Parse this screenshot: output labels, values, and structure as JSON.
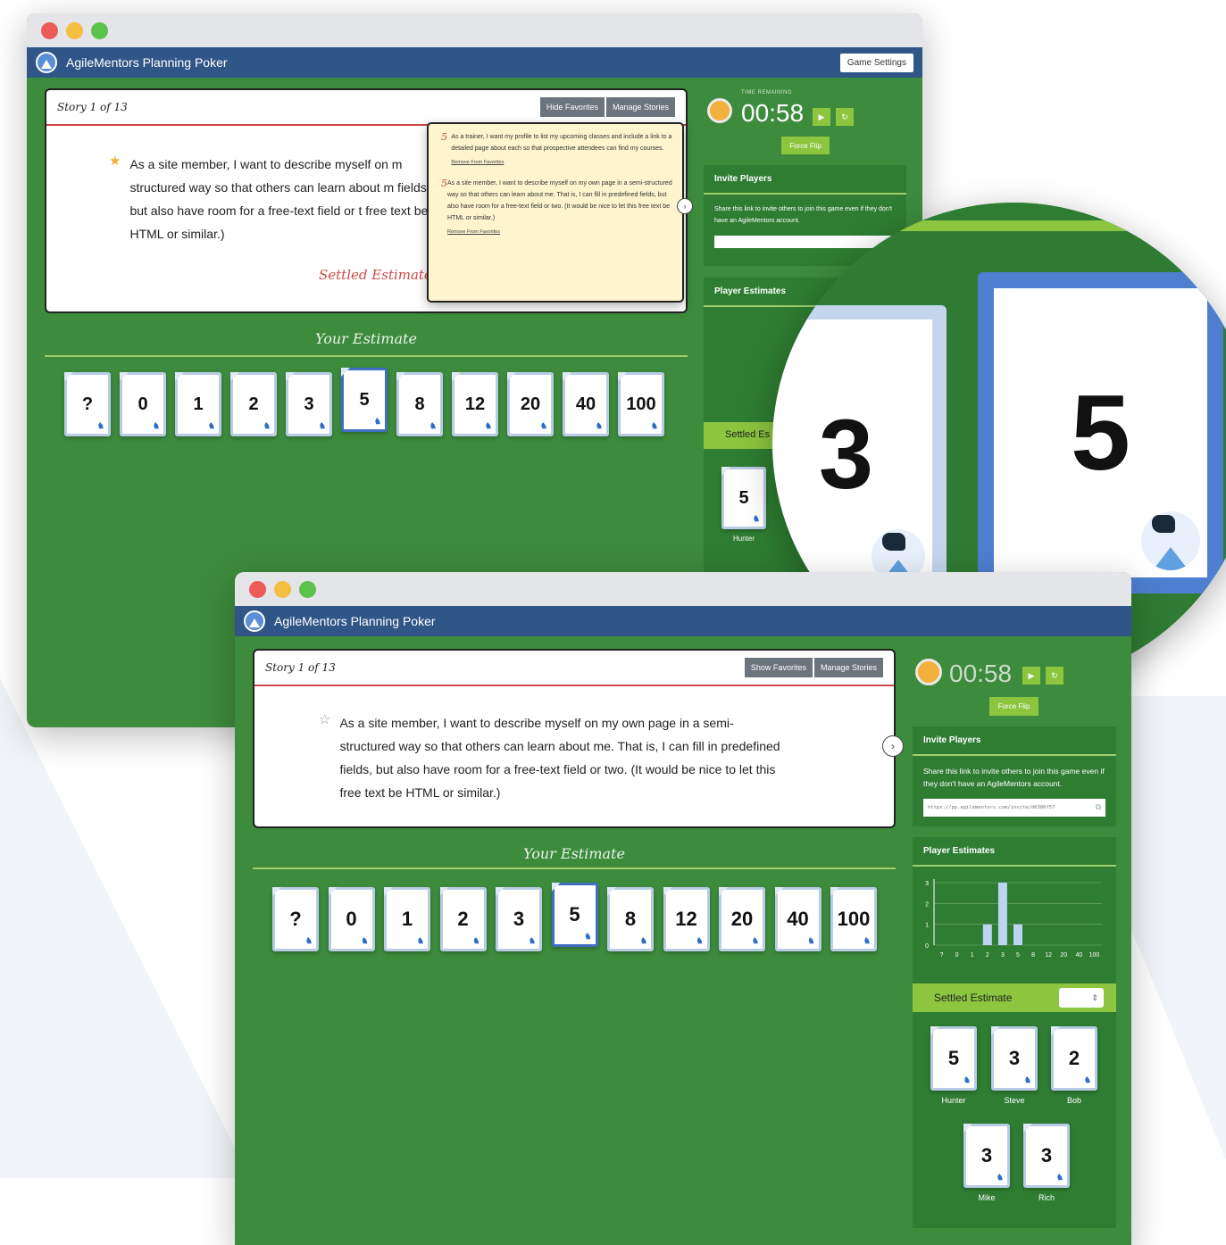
{
  "app": {
    "title": "AgileMentors Planning Poker",
    "game_settings_label": "Game Settings"
  },
  "back_window": {
    "story_count": "Story 1 of 13",
    "hide_favorites_label": "Hide Favorites",
    "manage_stories_label": "Manage Stories",
    "story_text": "As a site member, I want to describe myself on m structured way so that others can learn about m fields, but also have room for a free-text field or t free text be HTML or similar.)",
    "settled_estimate_label": "Settled Estimate:",
    "your_estimate_label": "Your Estimate",
    "timer_label": "TIME REMAINING",
    "timer_value": "00:58",
    "force_flip_label": "Force Flip",
    "invite_players_label": "Invite Players",
    "invite_text": "Share this link to invite others to join this game even if they don't have an AgileMentors account.",
    "player_estimates_label": "Player Estimates",
    "settled_partial": "Settled Es",
    "hunter_label": "Hunter",
    "hunter_value": "5",
    "favorites": [
      {
        "estimate": "5",
        "text": "As a trainer, I want my profile to list my upcoming classes and include a link to a detailed page about each so that prospective attendees can find my courses.",
        "remove": "Remove From Favorites"
      },
      {
        "estimate": "5",
        "text": "As a site member, I want to describe myself on my own page in a semi-structured way so that others can learn about me. That is, I can fill in predefined fields, but also have room for a free-text field or two. (It would be nice to let this free text be HTML or similar.)",
        "remove": "Remove From Favorites"
      }
    ]
  },
  "front_window": {
    "story_count": "Story 1 of 13",
    "show_favorites_label": "Show Favorites",
    "manage_stories_label": "Manage Stories",
    "story_text_1": "As a site member, I want to describe myself on my own page in a semi-",
    "story_text_2": "structured way so that others can learn about me. That is, I can fill in predefined",
    "story_text_3": "fields, but also have room for a free-text field or two. (It would be nice to let this",
    "story_text_4": "free text be HTML or similar.)",
    "your_estimate_label": "Your Estimate",
    "timer_value": "00:58",
    "force_flip_label": "Force Flip",
    "invite_players_label": "Invite Players",
    "invite_text": "Share this link to invite others to join this game even if they don't have an AgileMentors account.",
    "invite_url": "https://pp.agilementors.com/invite/d6386f57",
    "player_estimates_label": "Player Estimates",
    "settled_estimate_label": "Settled Estimate"
  },
  "cards": [
    "?",
    "0",
    "1",
    "2",
    "3",
    "5",
    "8",
    "12",
    "20",
    "40",
    "100"
  ],
  "selected_card": "5",
  "players": [
    {
      "name": "Hunter",
      "estimate": "5"
    },
    {
      "name": "Steve",
      "estimate": "3"
    },
    {
      "name": "Bob",
      "estimate": "2"
    },
    {
      "name": "Mike",
      "estimate": "3"
    },
    {
      "name": "Rich",
      "estimate": "3"
    }
  ],
  "lens": {
    "card_left": "3",
    "card_right": "5"
  },
  "chart_data": {
    "type": "bar",
    "title": "",
    "xlabel": "",
    "ylabel": "",
    "categories": [
      "?",
      "0",
      "1",
      "2",
      "3",
      "5",
      "8",
      "12",
      "20",
      "40",
      "100"
    ],
    "values": [
      0,
      0,
      0,
      1,
      3,
      1,
      0,
      0,
      0,
      0,
      0
    ],
    "ylim": [
      0,
      3
    ],
    "yticks": [
      "0",
      "1",
      "2",
      "3"
    ],
    "grid": true,
    "colors": {
      "bar": "#bcd4f0",
      "axis": "#ffffff"
    }
  },
  "colors": {
    "accent_green": "#8cc63f",
    "table_green": "#3d8b3d",
    "appbar_blue": "#2f5687",
    "card_border": "#b9cce6",
    "selected_card_border": "#3f6fc2",
    "favorite_red": "#d04848"
  }
}
